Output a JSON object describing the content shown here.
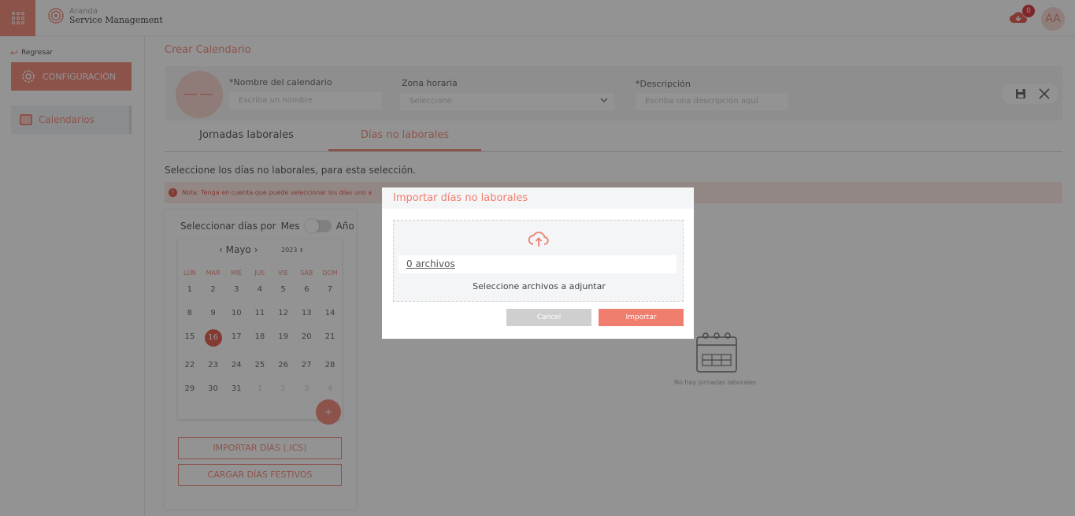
{
  "app": {
    "brand_line1": "Aranda",
    "brand_line2": "Service Management",
    "notification_count": "0",
    "user_initials": "AA"
  },
  "sidebar": {
    "back_label": "Regresar",
    "config_label": "CONFIGURACIÓN",
    "calendars_label": "Calendarios"
  },
  "page": {
    "title": "Crear Calendario",
    "avatar_initials": "——",
    "name_label": "*Nombre del calendario",
    "name_placeholder": "Escriba un nombre",
    "timezone_label": "Zona horaria",
    "timezone_value": "Seleccione",
    "description_label": "*Descripción",
    "description_placeholder": "Escriba una descripción aquí",
    "tabs": [
      {
        "label": "Jornadas laborales",
        "active": false
      },
      {
        "label": "Días no laborales",
        "active": true
      }
    ],
    "instruction": "Seleccione los días no laborales, para esta selección.",
    "note": "Nota: Tenga en cuenta que puede seleccionar los días uno a"
  },
  "calendar": {
    "select_by_label": "Seleccionar días por",
    "toggle_left": "Mes",
    "toggle_right": "Año",
    "month": "Mayo",
    "year": "2023",
    "weekdays": [
      "LUN",
      "MAR",
      "MIÉ",
      "JUE",
      "VIE",
      "SÁB",
      "DOM"
    ],
    "weeks": [
      [
        "1",
        "2",
        "3",
        "4",
        "5",
        "6",
        "7"
      ],
      [
        "8",
        "9",
        "10",
        "11",
        "12",
        "13",
        "14"
      ],
      [
        "15",
        "16",
        "17",
        "18",
        "19",
        "20",
        "21"
      ],
      [
        "22",
        "23",
        "24",
        "25",
        "26",
        "27",
        "28"
      ],
      [
        "29",
        "30",
        "31",
        "1",
        "2",
        "3",
        "4"
      ]
    ],
    "selected_day": "16",
    "add_label": "+",
    "import_button": "IMPORTAR DÍAS (.ICS)",
    "holidays_button": "CARGAR DÍAS FESTIVOS"
  },
  "empty_state": {
    "text": "No hay jornadas laborales"
  },
  "modal": {
    "title": "Importar días no laborales",
    "files_link": "0 archivos",
    "hint": "Seleccione archivos a adjuntar",
    "cancel_label": "Cancel",
    "import_label": "Importar"
  }
}
